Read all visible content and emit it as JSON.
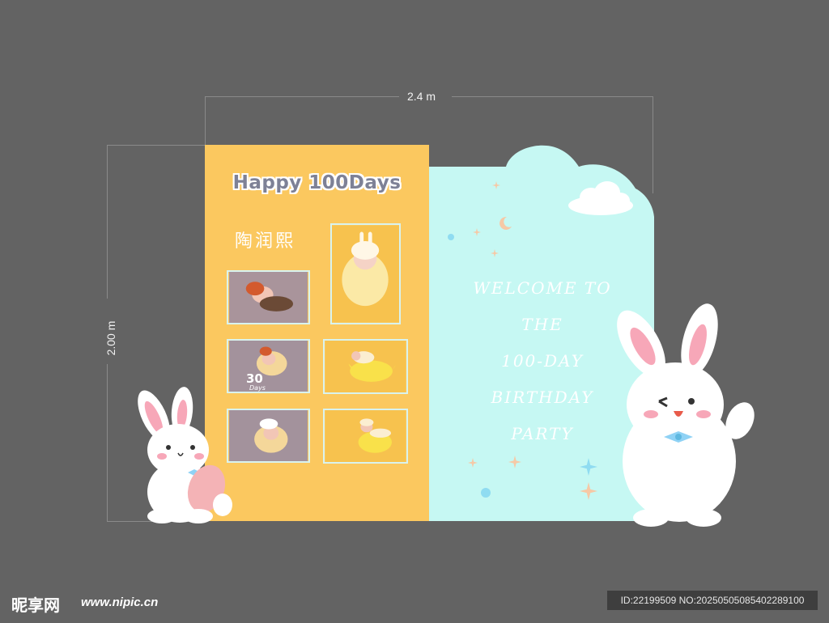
{
  "dimensions": {
    "width_label": "2.4 m",
    "height_label": "2.00 m"
  },
  "left_panel": {
    "title": "Happy 100Days",
    "name": "陶润熙",
    "photo_badge_number": "30",
    "photo_badge_text": "Days",
    "background_color": "#fbc85f"
  },
  "right_panel": {
    "welcome_lines": [
      "WELCOME TO",
      "THE",
      "100-DAY",
      "BIRTHDAY",
      "PARTY"
    ],
    "background_color": "#c6f8f3"
  },
  "watermark": {
    "logo": "昵享网",
    "url": "www.nipic.cn",
    "id_text": "ID:22199509 NO:20250505085402289100"
  }
}
